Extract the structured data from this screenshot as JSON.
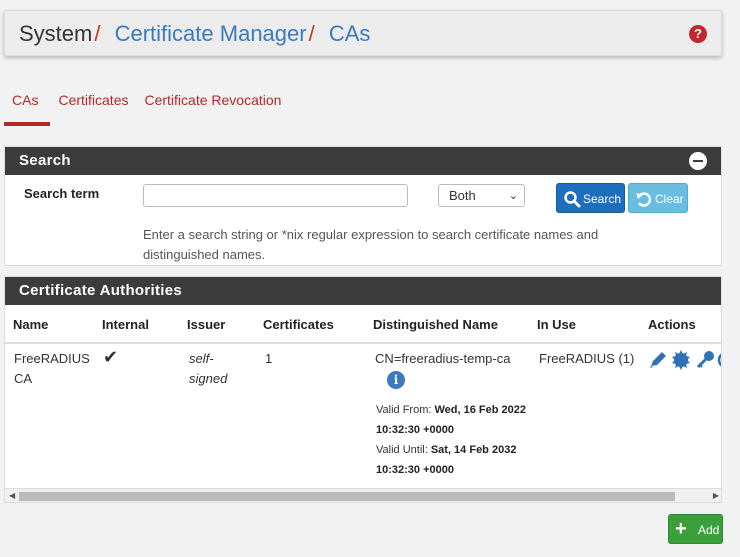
{
  "breadcrumb": {
    "root": "System",
    "separator": "/",
    "items": [
      "Certificate Manager",
      "CAs"
    ]
  },
  "help_icon": "question-circle-icon",
  "tabs": [
    {
      "label": "CAs",
      "active": true
    },
    {
      "label": "Certificates",
      "active": false
    },
    {
      "label": "Certificate Revocation",
      "active": false
    }
  ],
  "search": {
    "title": "Search",
    "term_label": "Search term",
    "term_value": "",
    "scope_selected": "Both",
    "search_button": "Search",
    "clear_button": "Clear",
    "help": "Enter a search string or *nix regular expression to search certificate names and distinguished names."
  },
  "ca_panel": {
    "title": "Certificate Authorities",
    "columns": [
      "Name",
      "Internal",
      "Issuer",
      "Certificates",
      "Distinguished Name",
      "In Use",
      "Actions"
    ],
    "rows": [
      {
        "name": "FreeRADIUS CA",
        "internal": "✔",
        "issuer": "self-signed",
        "certificates": "1",
        "dn": "CN=freeradius-temp-ca",
        "valid_from_label": "Valid From:",
        "valid_from": "Wed, 16 Feb 2022 10:32:30 +0000",
        "valid_until_label": "Valid Until:",
        "valid_until": "Sat, 14 Feb 2032 10:32:30 +0000",
        "in_use": "FreeRADIUS (1)",
        "actions": [
          "pencil-icon",
          "certificate-icon",
          "key-icon",
          "reload-icon"
        ]
      }
    ]
  },
  "add_button": "Add",
  "colors": {
    "accent": "#b12a2a",
    "link": "#3a7bbf",
    "panel_head": "#3c3c3c",
    "primary": "#1d6fbd",
    "success": "#3ba03b"
  }
}
